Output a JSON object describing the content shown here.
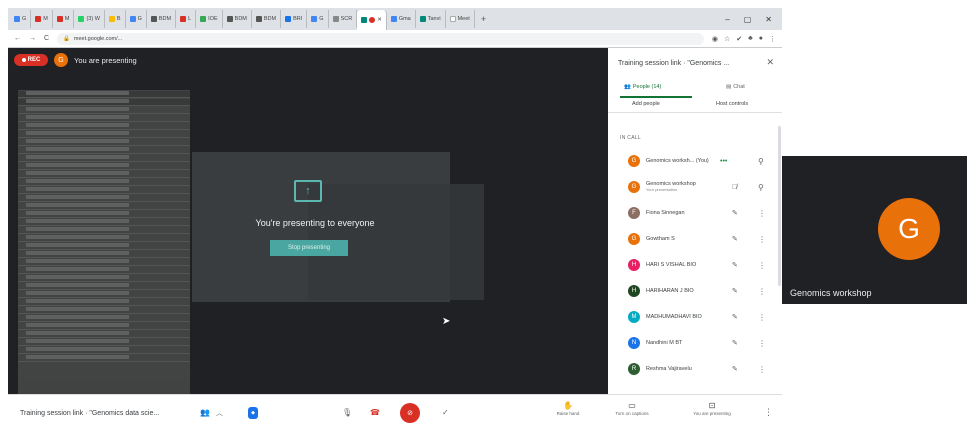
{
  "browser": {
    "tabs": [
      "G",
      "M",
      "M",
      "(3) W",
      "B",
      "G",
      "BDM",
      "L",
      "IOE",
      "BDM",
      "BDM",
      "BRI",
      "G",
      "SCR",
      "G",
      "Gma",
      "Tanvi",
      "Meet"
    ],
    "address": "meet.google.com/..."
  },
  "meeting": {
    "rec_label": "REC",
    "presenter_initial": "G",
    "presenting_label": "You are presenting",
    "present_message": "You're presenting to everyone",
    "stop_button": "Stop presenting"
  },
  "panel": {
    "title": "Training session link · \"Genomics ...",
    "tab_people": "People (14)",
    "tab_chat": "Chat",
    "add_people": "Add people",
    "host_controls": "Host controls",
    "in_call_label": "IN CALL",
    "people": [
      {
        "initial": "G",
        "name": "Genomics worksh... (You)",
        "sub": "",
        "color": "#e8710a"
      },
      {
        "initial": "G",
        "name": "Genomics workshop",
        "sub": "Your presentation",
        "color": "#e8710a"
      },
      {
        "initial": "F",
        "name": "Fiona Sinnegan",
        "sub": "",
        "color": "#8d6e63"
      },
      {
        "initial": "G",
        "name": "Gowtham S",
        "sub": "",
        "color": "#e8710a"
      },
      {
        "initial": "H",
        "name": "HARI S VISHAL BIO",
        "sub": "",
        "color": "#e91e63"
      },
      {
        "initial": "H",
        "name": "HARIHARAN J BIO",
        "sub": "",
        "color": "#1e4620"
      },
      {
        "initial": "M",
        "name": "MADHUMADHAVI BIO",
        "sub": "",
        "color": "#00acc1"
      },
      {
        "initial": "N",
        "name": "Nandhini M BT",
        "sub": "",
        "color": "#1a73e8"
      },
      {
        "initial": "R",
        "name": "Reshma Vajiravelu",
        "sub": "",
        "color": "#2e5d32"
      }
    ]
  },
  "bottombar": {
    "meeting_name": "Training session link · \"Genomics data scie...",
    "raise_hand": "Raise hand",
    "captions": "Turn on captions",
    "presenting": "You are presenting"
  },
  "selfview": {
    "initial": "G",
    "name": "Genomics workshop"
  }
}
